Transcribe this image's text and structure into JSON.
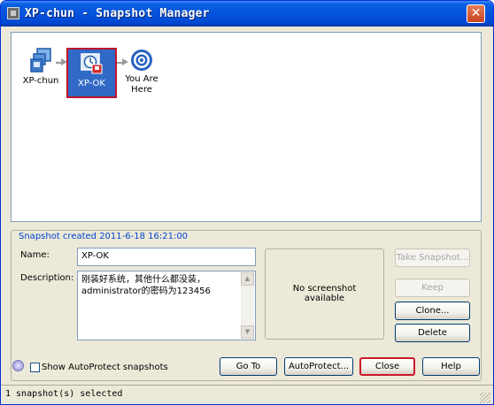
{
  "window": {
    "title": "XP-chun - Snapshot Manager",
    "close_glyph": "✕",
    "accent": "#0a5fe3"
  },
  "tree": {
    "nodes": [
      {
        "label": "XP-chun",
        "icon": "vm-computer-icon"
      },
      {
        "label": "XP-OK",
        "icon": "snapshot-clock-icon",
        "selected": true
      },
      {
        "label": "You Are Here",
        "icon": "target-icon"
      }
    ]
  },
  "details": {
    "group_title": "Snapshot created 2011-6-18 16:21:00",
    "name_label": "Name:",
    "name_value": "XP-OK",
    "description_label": "Description:",
    "description_line1": "刚装好系统，其他什么都没装，",
    "description_line2": "administrator的密码为123456",
    "preview_line1": "No screenshot",
    "preview_line2": "available"
  },
  "side_buttons": {
    "take_snapshot": "Take Snapshot...",
    "keep": "Keep",
    "clone": "Clone...",
    "delete": "Delete"
  },
  "bottom": {
    "autoprotect_checkbox_label": "Show AutoProtect snapshots",
    "autoprotect_checked": false,
    "go_to": "Go To",
    "autoprotect": "AutoProtect...",
    "close": "Close",
    "help": "Help"
  },
  "status": {
    "text": "1 snapshot(s) selected"
  }
}
